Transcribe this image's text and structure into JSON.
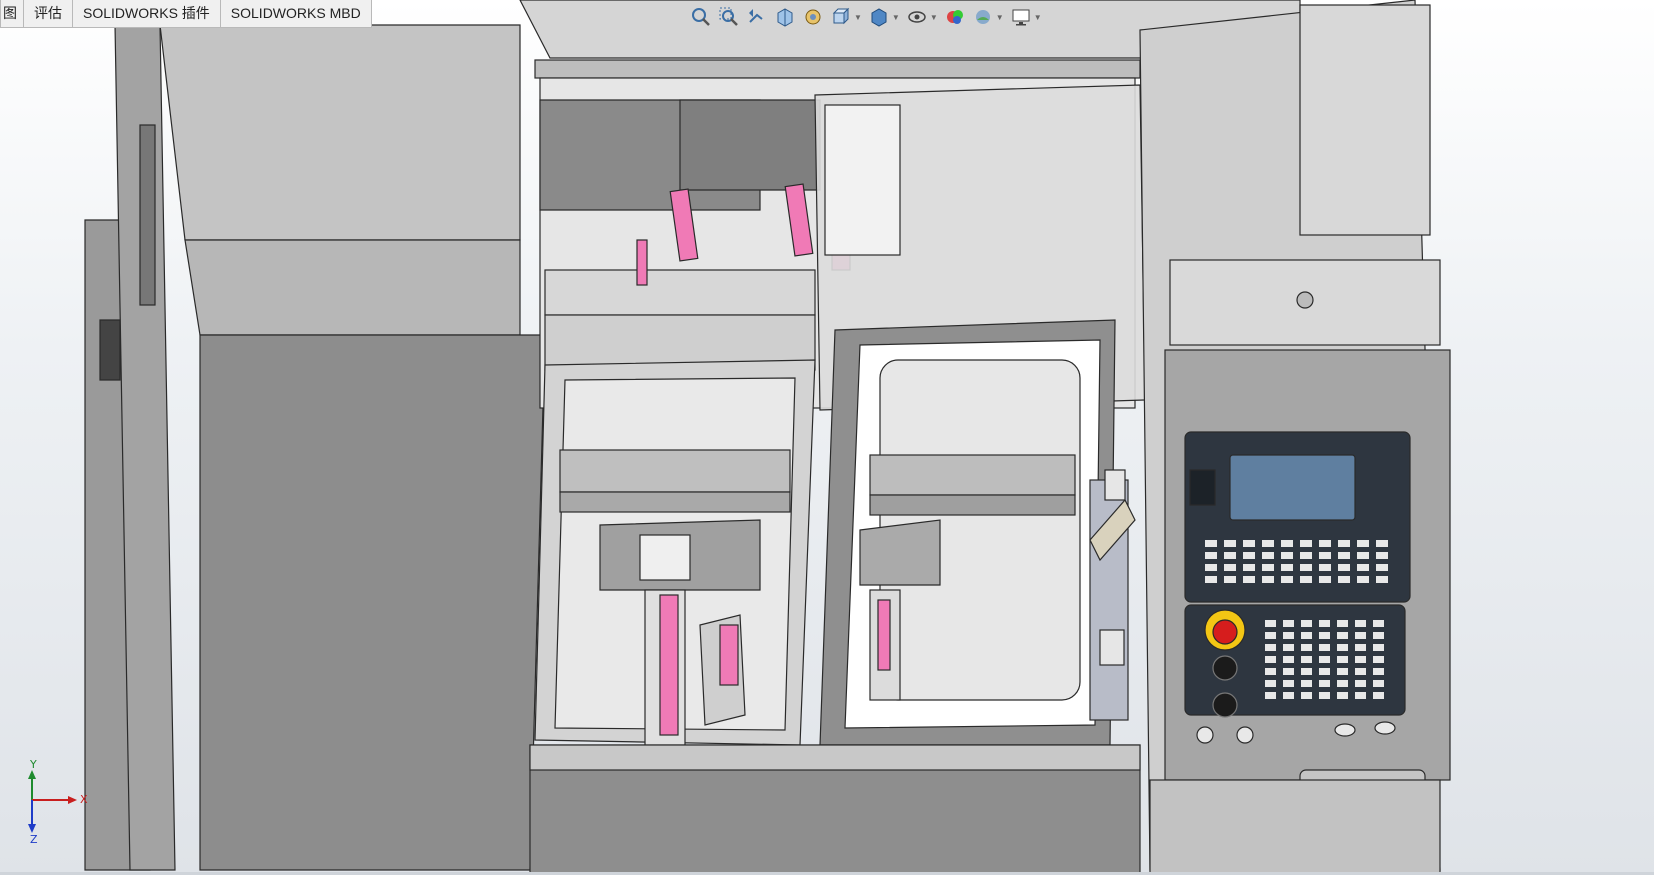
{
  "tabs": [
    {
      "label": "图"
    },
    {
      "label": "评估"
    },
    {
      "label": "SOLIDWORKS 插件"
    },
    {
      "label": "SOLIDWORKS MBD"
    }
  ],
  "heads_up_toolbar": {
    "icons": [
      "zoom-to-fit-icon",
      "zoom-to-area-icon",
      "previous-view-icon",
      "section-view-icon",
      "dynamic-annotation-icon",
      "view-orientation-icon",
      "display-style-icon",
      "hide-show-items-icon",
      "edit-appearance-icon",
      "apply-scene-icon",
      "view-settings-icon"
    ]
  },
  "triad": {
    "x_label": "X",
    "y_label": "Y",
    "z_label": "Z"
  },
  "colors": {
    "accent_pink": "#f07ab6",
    "panel_dark": "#2e3640",
    "screen_blue": "#5f7fa0",
    "emergency_red": "#d61d1d",
    "emergency_yellow": "#f3c614"
  }
}
